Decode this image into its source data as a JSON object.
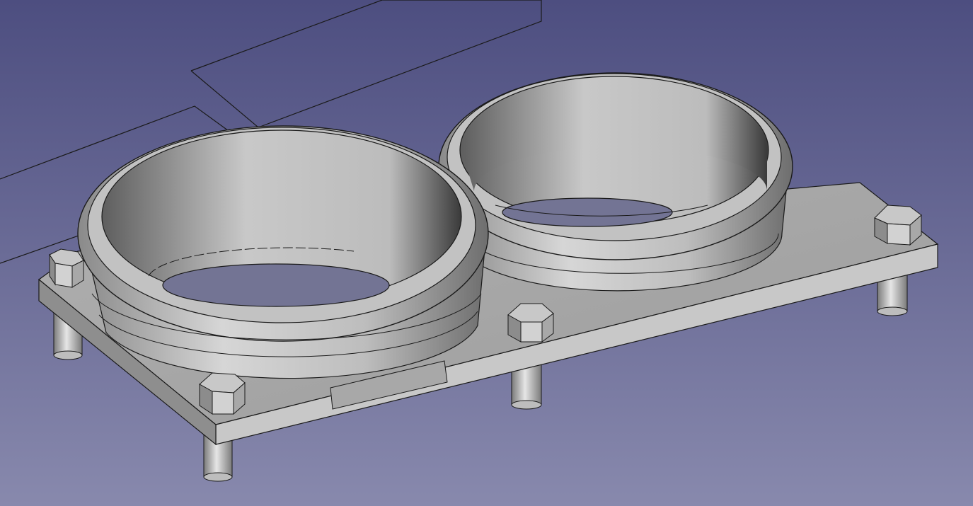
{
  "viewport": {
    "background_top": "#4d4e80",
    "background_bottom": "#8889ad"
  },
  "model": {
    "fill_light": "#d8d8d8",
    "fill_mid": "#b4b4b4",
    "fill_dark": "#8c8c8c",
    "edge_color": "#1a1a1a",
    "objects": [
      "grid-outline-back",
      "grid-outline-front",
      "base-plate",
      "left-ring",
      "right-ring",
      "hex-nut",
      "standoff-leg",
      "label-slot"
    ]
  }
}
